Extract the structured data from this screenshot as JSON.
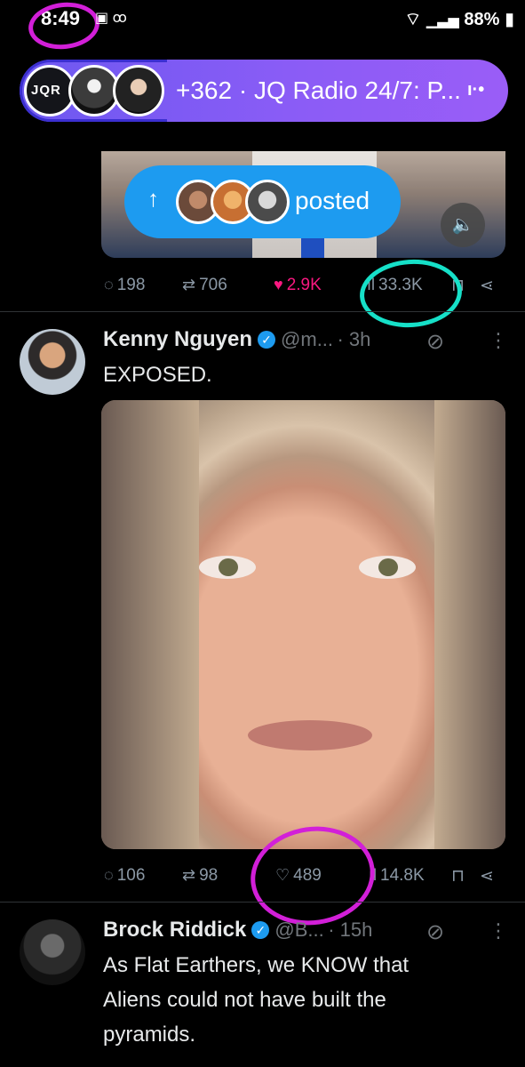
{
  "status_bar": {
    "time": "8:49",
    "left_icons": "▣ ꝏ",
    "battery": "88%"
  },
  "space_bar": {
    "logo_text": "JQR",
    "text": "+362 · JQ Radio 24/7: P..."
  },
  "repost_banner": {
    "label": "posted"
  },
  "prev_actions": {
    "replies": "198",
    "reposts": "706",
    "likes": "2.9K",
    "views": "33.3K"
  },
  "tweet1": {
    "name": "Kenny Nguyen",
    "handle": "@m...",
    "time": "· 3h",
    "text": "EXPOSED.",
    "actions": {
      "replies": "106",
      "reposts": "98",
      "likes": "489",
      "views": "14.8K"
    }
  },
  "tweet2": {
    "name": "Brock Riddick",
    "handle": "@B...",
    "time": "· 15h",
    "text_lines": [
      "As Flat Earthers, we KNOW that",
      "Aliens could not have built the",
      "pyramids."
    ]
  },
  "colors": {
    "accent": "#1d9bf0",
    "like": "#f91880",
    "annotation_magenta": "#d21fd8",
    "annotation_teal": "#16e0c8",
    "space_purple": "#8a5cf6"
  },
  "icons": [
    "reply-icon",
    "repost-icon",
    "like-icon",
    "views-icon",
    "bookmark-icon",
    "share-icon",
    "grok-icon",
    "more-icon",
    "verified-icon",
    "volume-icon",
    "wifi-icon",
    "signal-icon",
    "battery-icon"
  ]
}
